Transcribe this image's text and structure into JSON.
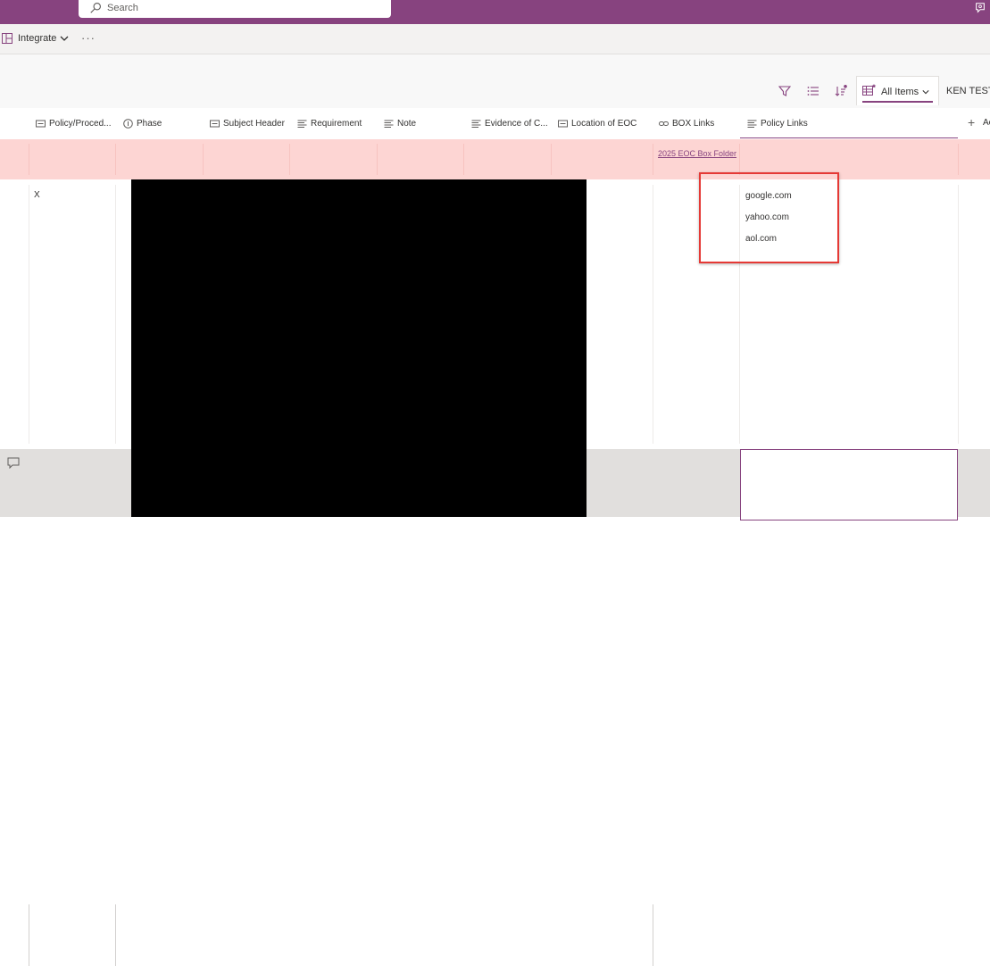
{
  "search": {
    "placeholder": "Search"
  },
  "command_bar": {
    "integrate_label": "Integrate",
    "more_label": "···"
  },
  "views": {
    "active_tab": "All Items",
    "second_tab": "KEN TEST"
  },
  "columns": [
    {
      "label": "Policy/Proced...",
      "icon": "text-field-icon"
    },
    {
      "label": "Phase",
      "icon": "choice-field-icon"
    },
    {
      "label": "Subject Header",
      "icon": "text-field-icon"
    },
    {
      "label": "Requirement",
      "icon": "multiline-text-icon"
    },
    {
      "label": "Note",
      "icon": "multiline-text-icon"
    },
    {
      "label": "Evidence of C...",
      "icon": "multiline-text-icon"
    },
    {
      "label": "Location of EOC",
      "icon": "text-field-icon"
    },
    {
      "label": "BOX Links",
      "icon": "link-icon"
    },
    {
      "label": "Policy Links",
      "icon": "multiline-text-icon"
    }
  ],
  "add_column_label": "Ac",
  "rows": [
    {
      "box_link": "2025 EOC Box Folder"
    },
    {
      "policy_procedure": "X",
      "policy_links": [
        "google.com",
        "yahoo.com",
        "aol.com"
      ]
    }
  ],
  "colors": {
    "accent": "#87437f",
    "highlight_row": "#fdd5d3",
    "annotation_box": "#e53935"
  }
}
